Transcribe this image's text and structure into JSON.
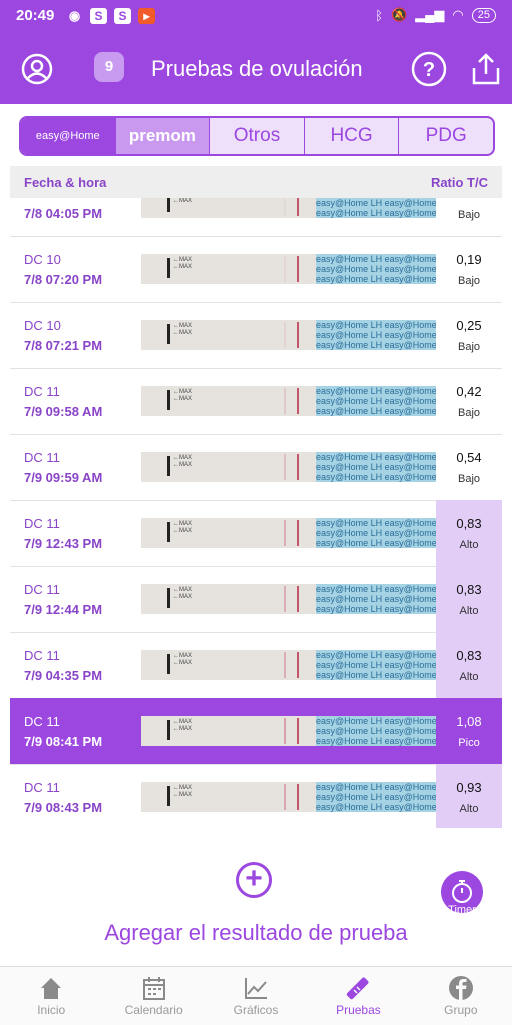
{
  "status_bar": {
    "time": "20:49",
    "battery": "25"
  },
  "app_bar": {
    "title": "Pruebas de ovulación",
    "badge": "9"
  },
  "tabs": [
    {
      "label": "easy@Home",
      "selected": true
    },
    {
      "label": "premom",
      "selected": false
    },
    {
      "label": "Otros",
      "selected": false
    },
    {
      "label": "HCG",
      "selected": false
    },
    {
      "label": "PDG",
      "selected": false
    }
  ],
  "table": {
    "col_date": "Fecha & hora",
    "col_ratio": "Ratio T/C"
  },
  "strip_text": {
    "max": "←MAX",
    "lh": "easy@Home LH easy@Home LH easy@Home LH"
  },
  "rows": [
    {
      "dc": "",
      "datetime": "7/8  04:05 PM",
      "ratio": "",
      "status": "Bajo",
      "test_line": 0.1
    },
    {
      "dc": "DC 10",
      "datetime": "7/8  07:20 PM",
      "ratio": "0,19",
      "status": "Bajo",
      "test_line": 0.19
    },
    {
      "dc": "DC 10",
      "datetime": "7/8  07:21 PM",
      "ratio": "0,25",
      "status": "Bajo",
      "test_line": 0.25
    },
    {
      "dc": "DC 11",
      "datetime": "7/9  09:58 AM",
      "ratio": "0,42",
      "status": "Bajo",
      "test_line": 0.42
    },
    {
      "dc": "DC 11",
      "datetime": "7/9  09:59 AM",
      "ratio": "0,54",
      "status": "Bajo",
      "test_line": 0.54
    },
    {
      "dc": "DC 11",
      "datetime": "7/9  12:43 PM",
      "ratio": "0,83",
      "status": "Alto",
      "test_line": 0.83
    },
    {
      "dc": "DC 11",
      "datetime": "7/9  12:44 PM",
      "ratio": "0,83",
      "status": "Alto",
      "test_line": 0.83
    },
    {
      "dc": "DC 11",
      "datetime": "7/9  04:35 PM",
      "ratio": "0,83",
      "status": "Alto",
      "test_line": 0.83
    },
    {
      "dc": "DC 11",
      "datetime": "7/9  08:41 PM",
      "ratio": "1,08",
      "status": "Pico",
      "test_line": 1.0
    },
    {
      "dc": "DC 11",
      "datetime": "7/9  08:43 PM",
      "ratio": "0,93",
      "status": "Alto",
      "test_line": 0.93
    }
  ],
  "add_result": {
    "label": "Agregar el resultado de prueba"
  },
  "timer": {
    "label": "Timer"
  },
  "bottom_nav": [
    {
      "label": "Inicio",
      "icon": "home-icon"
    },
    {
      "label": "Calendario",
      "icon": "calendar-icon"
    },
    {
      "label": "Gráficos",
      "icon": "chart-icon"
    },
    {
      "label": "Pruebas",
      "icon": "test-strip-icon",
      "active": true
    },
    {
      "label": "Grupo",
      "icon": "facebook-icon"
    }
  ],
  "colors": {
    "primary": "#9b47e0",
    "high_bg": "#e1cdf6",
    "strip_bg": "#e6e3de",
    "strip_lh": "#a6d3e4"
  }
}
